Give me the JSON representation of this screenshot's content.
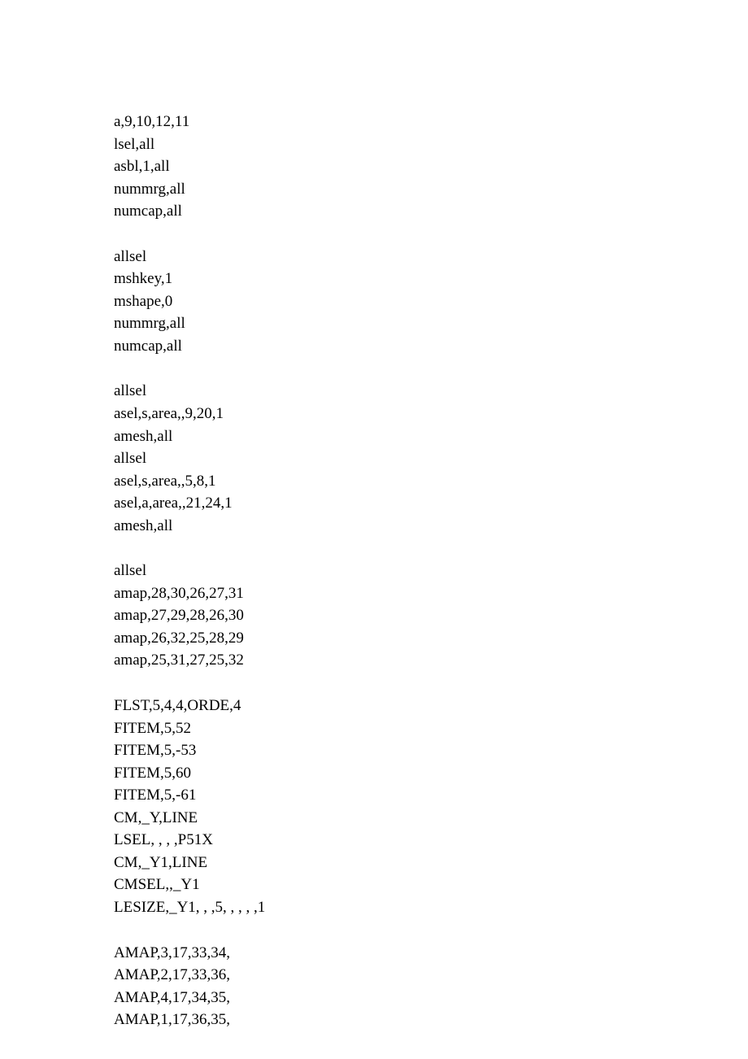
{
  "blocks": [
    [
      "a,9,10,12,11",
      "lsel,all",
      "asbl,1,all",
      "nummrg,all",
      "numcap,all"
    ],
    [
      "allsel",
      "mshkey,1",
      "mshape,0",
      "nummrg,all",
      "numcap,all"
    ],
    [
      "allsel",
      "asel,s,area,,9,20,1",
      "amesh,all",
      "allsel",
      "asel,s,area,,5,8,1",
      "asel,a,area,,21,24,1",
      "amesh,all"
    ],
    [
      "allsel",
      "amap,28,30,26,27,31",
      "amap,27,29,28,26,30",
      "amap,26,32,25,28,29",
      "amap,25,31,27,25,32"
    ],
    [
      "",
      "FLST,5,4,4,ORDE,4",
      "FITEM,5,52",
      "FITEM,5,-53",
      "FITEM,5,60",
      "FITEM,5,-61",
      "CM,_Y,LINE",
      "LSEL, , , ,P51X",
      "CM,_Y1,LINE",
      "CMSEL,,_Y1",
      "LESIZE,_Y1, , ,5, , , , ,1"
    ],
    [
      "AMAP,3,17,33,34,",
      "AMAP,2,17,33,36,",
      "AMAP,4,17,34,35,",
      "AMAP,1,17,36,35,"
    ]
  ]
}
